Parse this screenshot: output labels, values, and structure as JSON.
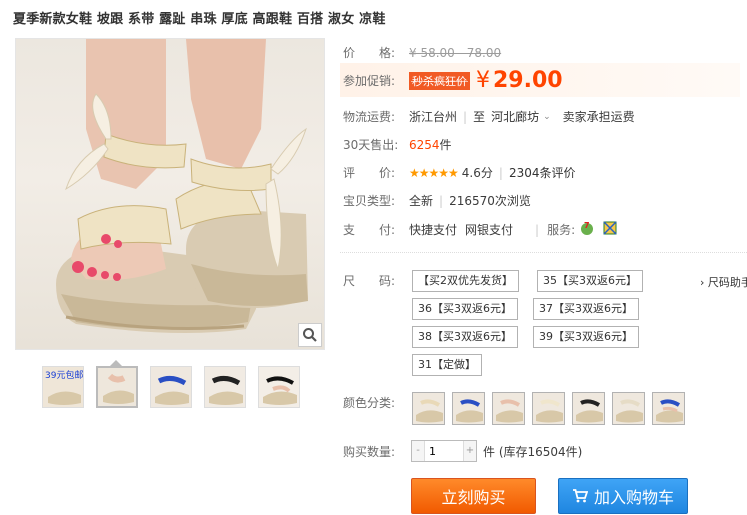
{
  "product": {
    "title": "夏季新款女鞋 坡跟 系带 露趾 串珠 厚底 高跟鞋 百搭 淑女 凉鞋"
  },
  "price": {
    "label": "价　　格:",
    "original": "¥ 58.00 - 78.00",
    "promo_label": "参加促销:",
    "promo_tag": "秒杀疯狂价",
    "currency": "¥",
    "promo_price": "29.00"
  },
  "shipping": {
    "label": "物流运费:",
    "from": "浙江台州",
    "to_word": "至",
    "to": "河北廊坊",
    "note": "卖家承担运费"
  },
  "sales": {
    "label_num": "30",
    "label": "天售出:",
    "count": "6254",
    "unit": "件"
  },
  "rating": {
    "label": "评　　价:",
    "stars": "★★★★★",
    "score": "4.6分",
    "reviews": "2304条评价"
  },
  "type": {
    "label": "宝贝类型:",
    "condition": "全新",
    "views": "216570次浏览"
  },
  "payment": {
    "label": "支　　付:",
    "method1": "快捷支付",
    "method2": "网银支付",
    "service_label": "服务:"
  },
  "sizes": {
    "label": "尺　　码:",
    "options": [
      "【买2双优先发货】",
      "35【买3双返6元】",
      "36【买3双返6元】",
      "37【买3双返6元】",
      "38【买3双返6元】",
      "39【买3双返6元】",
      "31【定做】"
    ],
    "more": "› 尺码助手"
  },
  "colors": {
    "label": "颜色分类:",
    "count": 7
  },
  "quantity": {
    "label": "购买数量:",
    "value": "1",
    "minus": "-",
    "plus": "+",
    "stock": "件 (库存16504件)"
  },
  "actions": {
    "buy": "立刻购买",
    "cart": "加入购物车"
  },
  "gallery": {
    "thumb_badge": "39元包邮"
  }
}
